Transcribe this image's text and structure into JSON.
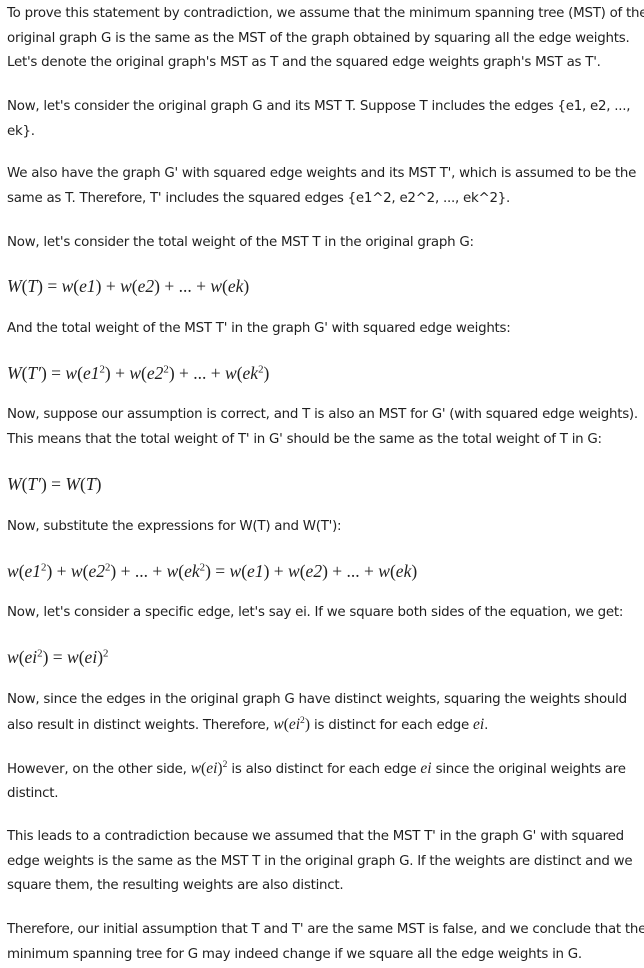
{
  "paragraphs": {
    "p1": {
      "l1": "To prove this statement by contradiction, we assume that the minimum spanning tree (MST) of the",
      "l2": "original graph G is the same as the MST of the graph obtained by squaring all the edge weights.",
      "l3": "Let's denote the original graph's MST as T and the squared edge weights graph's MST as T'."
    },
    "p2": {
      "l1": "Now, let's consider the original graph G and its MST T. Suppose T includes the edges {e1, e2, ...,",
      "l2": "ek}."
    },
    "p3": {
      "l1": "We also have the graph G' with squared edge weights and its MST T', which is assumed to be the",
      "l2": "same as T. Therefore, T' includes the squared edges {e1^2, e2^2, ..., ek^2}."
    },
    "p4": "Now, let's consider the total weight of the MST T in the original graph G:",
    "p5": "And the total weight of the MST T' in the graph G' with squared edge weights:",
    "p6": {
      "l1": "Now, suppose our assumption is correct, and T is also an MST for G' (with squared edge weights).",
      "l2": "This means that the total weight of T' in G' should be the same as the total weight of T in G:"
    },
    "p7": "Now, substitute the expressions for W(T) and W(T'):",
    "p8": "Now, let's consider a specific edge, let's say ei. If we square both sides of the equation, we get:",
    "p9": {
      "l1": "Now, since the edges in the original graph G have distinct weights, squaring the weights should",
      "l2_a": "also result in distinct weights. Therefore, ",
      "l2_b": " is distinct for each edge ",
      "l2_c": "."
    },
    "p10": {
      "l1_a": "However, on the other side, ",
      "l1_b": " is also distinct for each edge ",
      "l1_c": " since the original weights are",
      "l2": "distinct."
    },
    "p11": {
      "l1": "This leads to a contradiction because we assumed that the MST T' in the graph G' with squared",
      "l2": "edge weights is the same as the MST T in the original graph G. If the weights are distinct and we",
      "l3": "square them, the resulting weights are also distinct."
    },
    "p12": {
      "l1": "Therefore, our initial assumption that T and T' are the same MST is false, and we conclude that the",
      "l2": "minimum spanning tree for G may indeed change if we square all the edge weights in G."
    }
  },
  "equations": {
    "eq1": {
      "lhs_fn": "W",
      "lhs_arg": "T",
      "t1_fn": "w",
      "t1_arg": "e1",
      "t2_fn": "w",
      "t2_arg": "e2",
      "dots": "...",
      "t3_fn": "w",
      "t3_arg": "ek"
    },
    "eq2": {
      "lhs_fn": "W",
      "lhs_arg": "T′",
      "t1_fn": "w",
      "t1_arg": "e1",
      "t1_exp": "2",
      "t2_fn": "w",
      "t2_arg": "e2",
      "t2_exp": "2",
      "dots": "...",
      "t3_fn": "w",
      "t3_arg": "ek",
      "t3_exp": "2"
    },
    "eq3": {
      "l_fn": "W",
      "l_arg": "T′",
      "r_fn": "W",
      "r_arg": "T"
    },
    "eq4": {
      "a1_fn": "w",
      "a1_arg": "e1",
      "a1_exp": "2",
      "a2_fn": "w",
      "a2_arg": "e2",
      "a2_exp": "2",
      "dots1": "...",
      "a3_fn": "w",
      "a3_arg": "ek",
      "a3_exp": "2",
      "b1_fn": "w",
      "b1_arg": "e1",
      "b2_fn": "w",
      "b2_arg": "e2",
      "dots2": "...",
      "b3_fn": "w",
      "b3_arg": "ek"
    },
    "eq5": {
      "l_fn": "w",
      "l_arg": "ei",
      "l_exp": "2",
      "r_fn": "w",
      "r_arg": "ei",
      "r_exp": "2"
    }
  },
  "inline_math": {
    "p9_expr": {
      "fn": "w",
      "arg": "ei",
      "exp": "2"
    },
    "p9_var": "ei",
    "p10_expr": {
      "fn": "w",
      "arg": "ei",
      "exp": "2"
    },
    "p10_var": "ei"
  }
}
